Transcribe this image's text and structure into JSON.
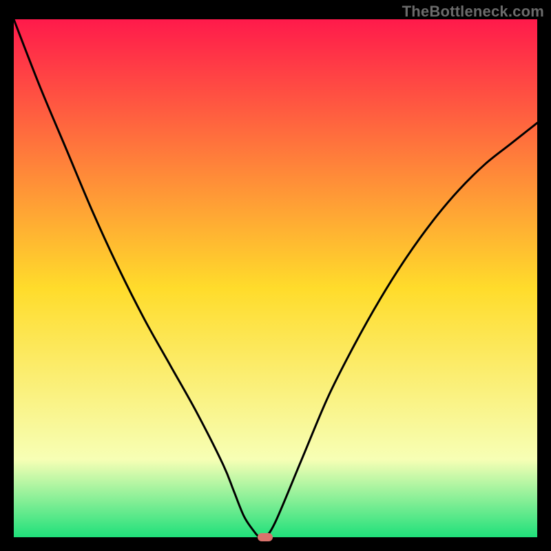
{
  "watermark": "TheBottleneck.com",
  "colors": {
    "frame": "#000000",
    "watermark": "#6b6b6b",
    "curve": "#000000",
    "gradient_top": "#ff1a4b",
    "gradient_mid": "#ffdc2b",
    "gradient_low": "#f7ffb5",
    "gradient_bottom": "#1fe07a",
    "marker": "#d9726c"
  },
  "chart_data": {
    "type": "line",
    "title": "",
    "xlabel": "",
    "ylabel": "",
    "xlim": [
      0,
      100
    ],
    "ylim": [
      0,
      100
    ],
    "x": [
      0,
      5,
      10,
      15,
      20,
      25,
      30,
      35,
      40,
      42,
      44,
      46,
      47,
      48,
      50,
      55,
      60,
      65,
      70,
      75,
      80,
      85,
      90,
      95,
      100
    ],
    "values": [
      100,
      87,
      75,
      63,
      52,
      42,
      33,
      24,
      14,
      9,
      4,
      1,
      0,
      0,
      3,
      15,
      27,
      37,
      46,
      54,
      61,
      67,
      72,
      76,
      80
    ],
    "flat_segment": {
      "x_start": 46,
      "x_end": 48,
      "y": 0
    },
    "marker": {
      "x": 48,
      "y": 0
    },
    "notes": "V-shaped bottleneck curve over vertical red→yellow→green gradient; axes have no tick labels."
  }
}
